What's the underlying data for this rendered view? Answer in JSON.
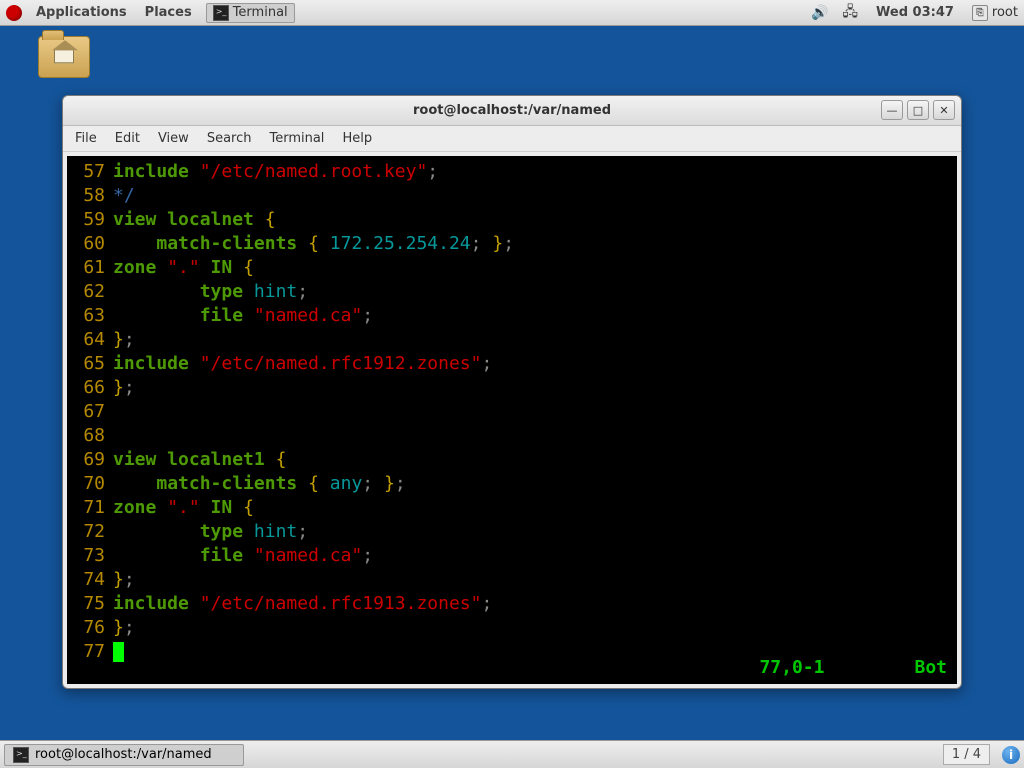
{
  "topbar": {
    "applications": "Applications",
    "places": "Places",
    "terminal": "Terminal",
    "clock": "Wed 03:47",
    "user": "root"
  },
  "window": {
    "title": "root@localhost:/var/named",
    "btn_min": "—",
    "btn_max": "□",
    "btn_close": "✕",
    "menu": {
      "file": "File",
      "edit": "Edit",
      "view": "View",
      "search": "Search",
      "terminal": "Terminal",
      "help": "Help"
    }
  },
  "editor": {
    "status_pos": "77,0-1",
    "status_pct": "Bot",
    "lines": [
      {
        "n": "57",
        "seg": [
          {
            "c": "kw-green",
            "t": "include "
          },
          {
            "c": "str-red",
            "t": "\"/etc/named.root.key\""
          },
          {
            "c": "gray",
            "t": ";"
          }
        ]
      },
      {
        "n": "58",
        "seg": [
          {
            "c": "comment",
            "t": "*/"
          }
        ]
      },
      {
        "n": "59",
        "seg": [
          {
            "c": "kw-green",
            "t": "view localnet "
          },
          {
            "c": "yellow",
            "t": "{"
          }
        ]
      },
      {
        "n": "60",
        "seg": [
          {
            "c": "",
            "t": "    "
          },
          {
            "c": "kw-green",
            "t": "match-clients "
          },
          {
            "c": "yellow",
            "t": "{ "
          },
          {
            "c": "ident",
            "t": "172.25.254.24"
          },
          {
            "c": "gray",
            "t": "; "
          },
          {
            "c": "yellow",
            "t": "}"
          },
          {
            "c": "gray",
            "t": ";"
          }
        ]
      },
      {
        "n": "61",
        "seg": [
          {
            "c": "kw-green",
            "t": "zone "
          },
          {
            "c": "str-red",
            "t": "\".\""
          },
          {
            "c": "kw-green",
            "t": " IN "
          },
          {
            "c": "yellow",
            "t": "{"
          }
        ]
      },
      {
        "n": "62",
        "seg": [
          {
            "c": "",
            "t": "        "
          },
          {
            "c": "kw-green",
            "t": "type "
          },
          {
            "c": "ident",
            "t": "hint"
          },
          {
            "c": "gray",
            "t": ";"
          }
        ]
      },
      {
        "n": "63",
        "seg": [
          {
            "c": "",
            "t": "        "
          },
          {
            "c": "kw-green",
            "t": "file "
          },
          {
            "c": "str-red",
            "t": "\"named.ca\""
          },
          {
            "c": "gray",
            "t": ";"
          }
        ]
      },
      {
        "n": "64",
        "seg": [
          {
            "c": "yellow",
            "t": "}"
          },
          {
            "c": "gray",
            "t": ";"
          }
        ]
      },
      {
        "n": "65",
        "seg": [
          {
            "c": "kw-green",
            "t": "include "
          },
          {
            "c": "str-red",
            "t": "\"/etc/named.rfc1912.zones\""
          },
          {
            "c": "gray",
            "t": ";"
          }
        ]
      },
      {
        "n": "66",
        "seg": [
          {
            "c": "yellow",
            "t": "}"
          },
          {
            "c": "gray",
            "t": ";"
          }
        ]
      },
      {
        "n": "67",
        "seg": []
      },
      {
        "n": "68",
        "seg": []
      },
      {
        "n": "69",
        "seg": [
          {
            "c": "kw-green",
            "t": "view localnet1 "
          },
          {
            "c": "yellow",
            "t": "{"
          }
        ]
      },
      {
        "n": "70",
        "seg": [
          {
            "c": "",
            "t": "    "
          },
          {
            "c": "kw-green",
            "t": "match-clients "
          },
          {
            "c": "yellow",
            "t": "{ "
          },
          {
            "c": "ident",
            "t": "any"
          },
          {
            "c": "gray",
            "t": "; "
          },
          {
            "c": "yellow",
            "t": "}"
          },
          {
            "c": "gray",
            "t": ";"
          }
        ]
      },
      {
        "n": "71",
        "seg": [
          {
            "c": "kw-green",
            "t": "zone "
          },
          {
            "c": "str-red",
            "t": "\".\""
          },
          {
            "c": "kw-green",
            "t": " IN "
          },
          {
            "c": "yellow",
            "t": "{"
          }
        ]
      },
      {
        "n": "72",
        "seg": [
          {
            "c": "",
            "t": "        "
          },
          {
            "c": "kw-green",
            "t": "type "
          },
          {
            "c": "ident",
            "t": "hint"
          },
          {
            "c": "gray",
            "t": ";"
          }
        ]
      },
      {
        "n": "73",
        "seg": [
          {
            "c": "",
            "t": "        "
          },
          {
            "c": "kw-green",
            "t": "file "
          },
          {
            "c": "str-red",
            "t": "\"named.ca\""
          },
          {
            "c": "gray",
            "t": ";"
          }
        ]
      },
      {
        "n": "74",
        "seg": [
          {
            "c": "yellow",
            "t": "}"
          },
          {
            "c": "gray",
            "t": ";"
          }
        ]
      },
      {
        "n": "75",
        "seg": [
          {
            "c": "kw-green",
            "t": "include "
          },
          {
            "c": "str-red",
            "t": "\"/etc/named.rfc1913.zones\""
          },
          {
            "c": "gray",
            "t": ";"
          }
        ]
      },
      {
        "n": "76",
        "seg": [
          {
            "c": "yellow",
            "t": "}"
          },
          {
            "c": "gray",
            "t": ";"
          }
        ]
      },
      {
        "n": "77",
        "seg": "cursor"
      }
    ]
  },
  "bottom": {
    "task_title": "root@localhost:/var/named",
    "workspace": "1 / 4"
  }
}
